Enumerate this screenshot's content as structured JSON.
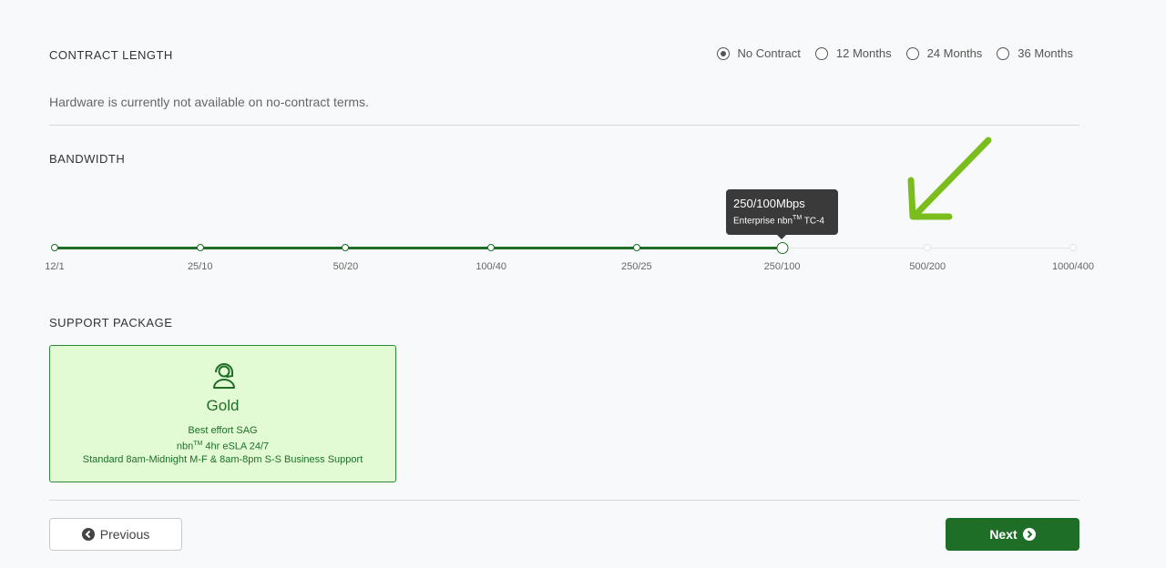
{
  "contract": {
    "title": "CONTRACT LENGTH",
    "options": [
      {
        "label": "No Contract",
        "selected": true
      },
      {
        "label": "12 Months",
        "selected": false
      },
      {
        "label": "24 Months",
        "selected": false
      },
      {
        "label": "36 Months",
        "selected": false
      }
    ],
    "note": "Hardware is currently not available on no-contract terms."
  },
  "bandwidth": {
    "title": "BANDWIDTH",
    "ticks": [
      "12/1",
      "25/10",
      "50/20",
      "100/40",
      "250/25",
      "250/100",
      "500/200",
      "1000/400"
    ],
    "selected_index": 5,
    "tooltip_title": "250/100Mbps",
    "tooltip_sub": "Enterprise nbn",
    "tooltip_sup": "TM",
    "tooltip_suffix": " TC-4"
  },
  "support": {
    "title": "SUPPORT PACKAGE",
    "card": {
      "icon": "headset-user-icon",
      "name": "Gold",
      "line1": "Best effort SAG",
      "line2_pre": "nbn",
      "line2_sup": "TM",
      "line2_post": " 4hr eSLA 24/7",
      "line3": "Standard 8am-Midnight M-F & 8am-8pm S-S Business Support"
    }
  },
  "nav": {
    "previous_label": "Previous",
    "next_label": "Next"
  },
  "colors": {
    "accent": "#1e6e28",
    "card_bg": "#e2fbd4",
    "arrow": "#7cbd1e"
  }
}
